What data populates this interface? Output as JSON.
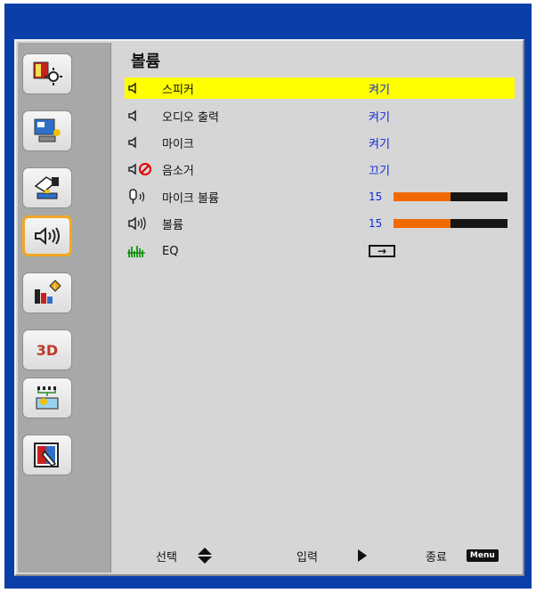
{
  "menu": {
    "title": "볼륨",
    "items": [
      {
        "label": "스피커",
        "value": "켜기",
        "icon": "speaker-icon",
        "selected": true
      },
      {
        "label": "오디오 출력",
        "value": "켜기",
        "icon": "speaker-icon"
      },
      {
        "label": "마이크",
        "value": "켜기",
        "icon": "speaker-icon"
      },
      {
        "label": "음소거",
        "value": "끄기",
        "icon": "mute-icon"
      },
      {
        "label": "마이크 볼륨",
        "value": "15",
        "icon": "microphone-volume-icon",
        "level_fraction": 0.5
      },
      {
        "label": "볼륨",
        "value": "15",
        "icon": "volume-icon",
        "level_fraction": 0.5
      },
      {
        "label": "EQ",
        "value": "→",
        "icon": "equalizer-icon"
      }
    ]
  },
  "sidebar": {
    "items": [
      {
        "icon": "image-settings-icon"
      },
      {
        "icon": "display-icon"
      },
      {
        "icon": "setup-icon"
      },
      {
        "icon": "volume-icon",
        "active": true
      },
      {
        "icon": "options-icon"
      },
      {
        "label": "3D",
        "icon": "3d-icon"
      },
      {
        "icon": "network-icon"
      },
      {
        "icon": "interactive-icon"
      }
    ]
  },
  "footer": {
    "select_label": "선택",
    "enter_label": "입력",
    "exit_label": "종료",
    "menu_key": "Menu"
  },
  "colors": {
    "frame": "#0a3fa8",
    "panel": "#d6d6d6",
    "sidebar": "#a8a8a8",
    "highlight": "#ffff00",
    "value_text": "#0d2bd6",
    "slider_fill": "#f06a00",
    "active_border": "#f5a623"
  }
}
